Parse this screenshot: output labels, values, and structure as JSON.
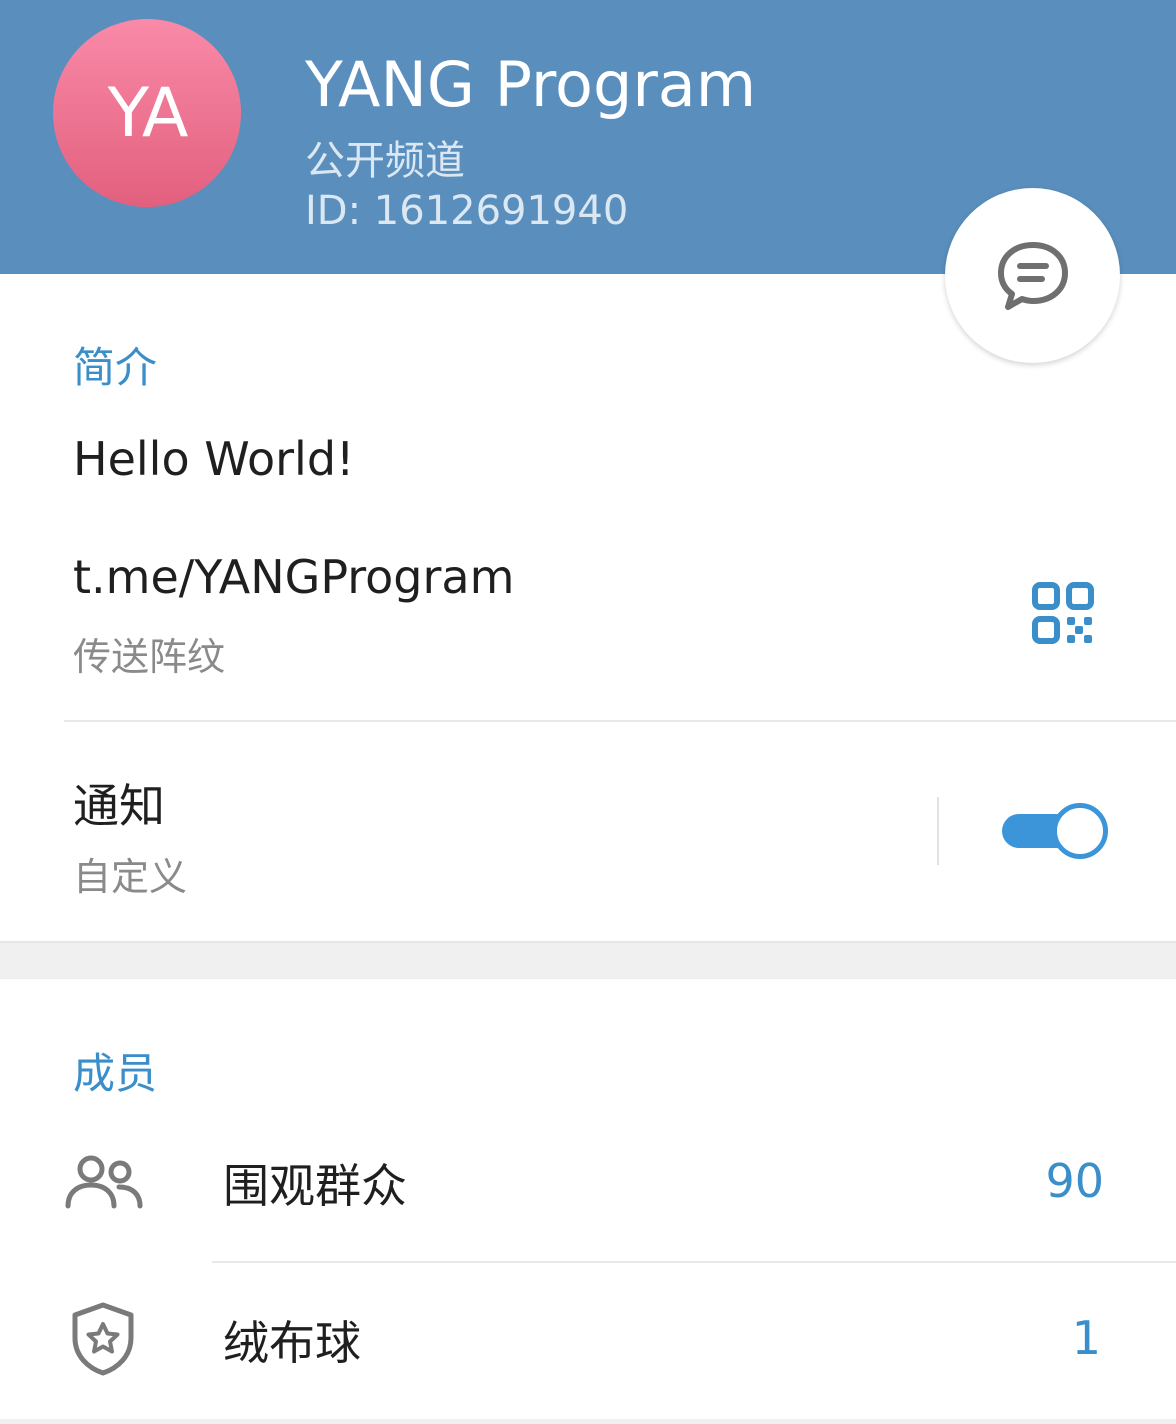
{
  "header": {
    "avatar_initials": "YA",
    "title": "YANG Program",
    "subtitle": "公开频道",
    "id_line": "ID: 1612691940",
    "colors": {
      "background": "#5a8fbd",
      "avatar_top": "#f98aa8",
      "avatar_bottom": "#e2607e"
    }
  },
  "fab": {
    "icon": "chat-bubble-icon"
  },
  "info": {
    "section_title": "简介",
    "about": "Hello World!",
    "link": "t.me/YANGProgram",
    "link_sub": "传送阵纹",
    "link_icon": "qr-code-icon",
    "notifications": {
      "label": "通知",
      "sub": "自定义",
      "enabled": true
    }
  },
  "members": {
    "section_title": "成员",
    "rows": [
      {
        "icon": "users-icon",
        "label": "围观群众",
        "count": "90"
      },
      {
        "icon": "shield-star-icon",
        "label": "绒布球",
        "count": "1"
      }
    ]
  },
  "accent_color": "#3a8ec9"
}
